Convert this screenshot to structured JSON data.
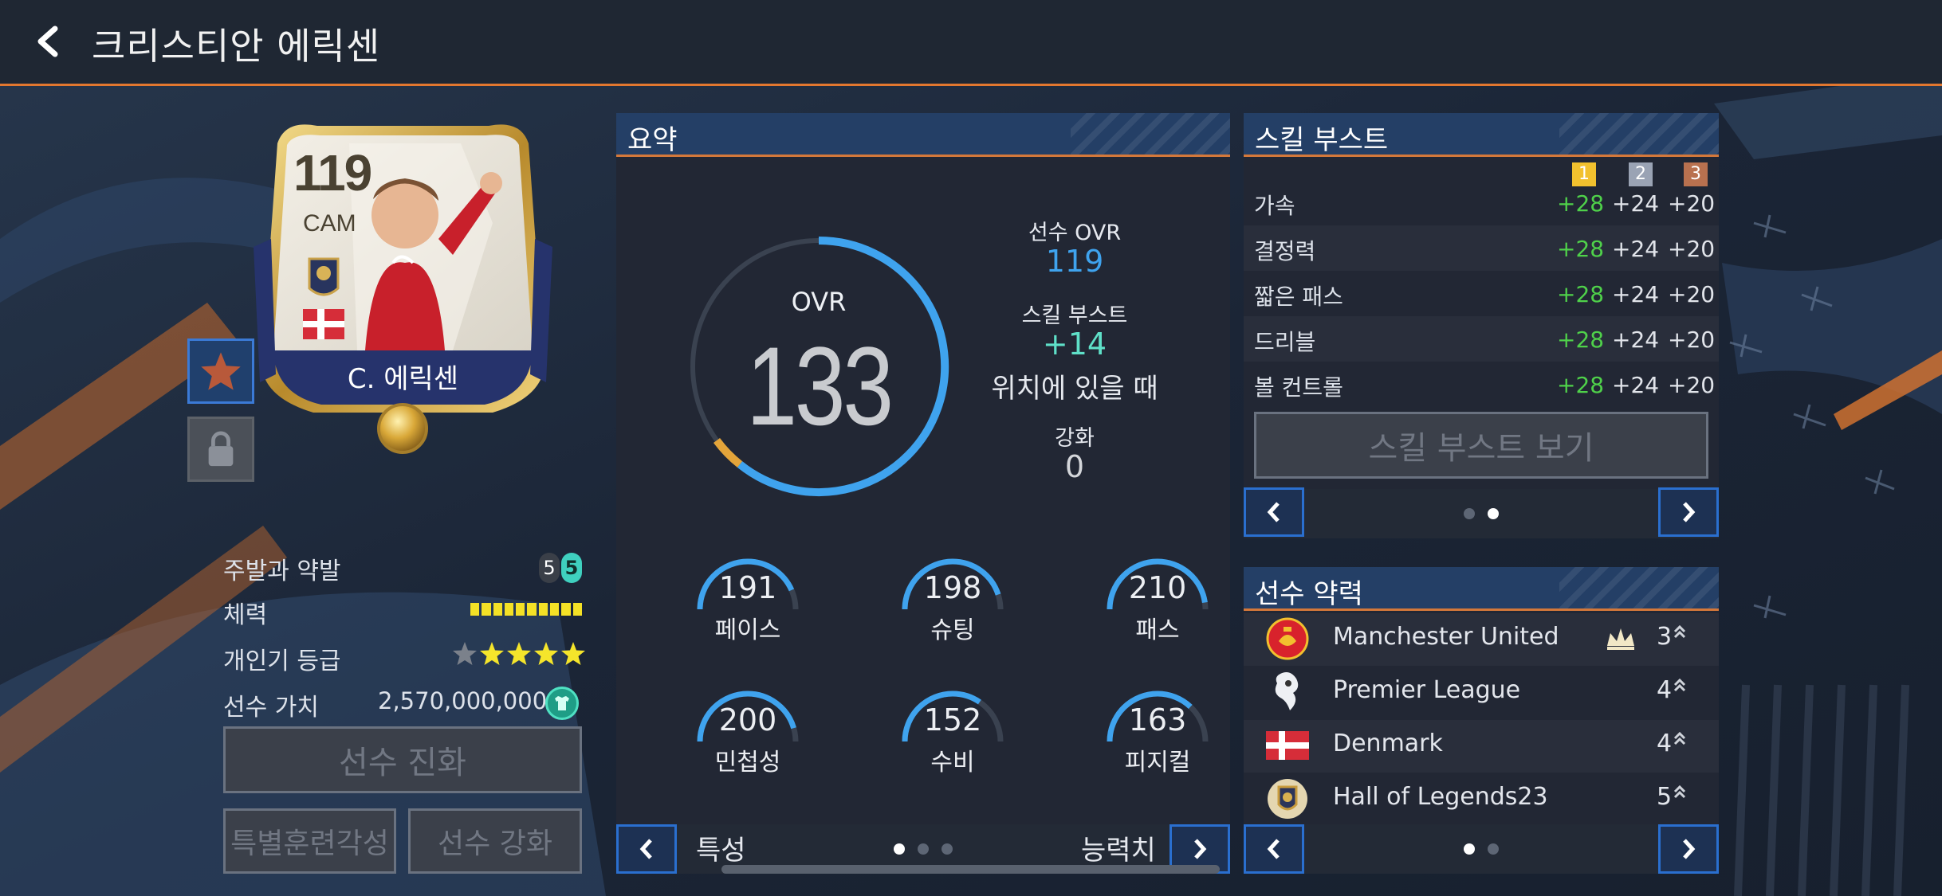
{
  "header": {
    "title": "크리스티안 에릭센"
  },
  "card": {
    "ovr": "119",
    "position": "CAM",
    "name": "C. 에릭센"
  },
  "info": {
    "foot_label": "주발과 약발",
    "foot_left": "5",
    "foot_right": "5",
    "stamina_label": "체력",
    "popularity_label": "개인기 등급",
    "popularity_stars_filled": 4,
    "popularity_stars_total": 5,
    "value_label": "선수 가치",
    "value": "2,570,000,000",
    "evolve_button": "선수 진화",
    "special_training_button": "특별훈련각성",
    "enhance_button": "선수 강화"
  },
  "summary": {
    "title": "요약",
    "ovr_label": "OVR",
    "ovr": "133",
    "player_ovr_label": "선수 OVR",
    "player_ovr": "119",
    "skill_boost_label": "스킬 부스트",
    "skill_boost": "+14",
    "position_note": "위치에 있을 때",
    "enhance_label": "강화",
    "enhance": "0",
    "stats": [
      {
        "value": "191",
        "label": "페이스"
      },
      {
        "value": "198",
        "label": "슈팅"
      },
      {
        "value": "210",
        "label": "패스"
      },
      {
        "value": "200",
        "label": "민첩성"
      },
      {
        "value": "152",
        "label": "수비"
      },
      {
        "value": "163",
        "label": "피지컬"
      }
    ],
    "nav_left": "특성",
    "nav_right": "능력치"
  },
  "skill_boost": {
    "title": "스킬 부스트",
    "headers": [
      "1",
      "2",
      "3"
    ],
    "rows": [
      {
        "label": "가속",
        "v1": "+28",
        "v2": "+24",
        "v3": "+20"
      },
      {
        "label": "결정력",
        "v1": "+28",
        "v2": "+24",
        "v3": "+20"
      },
      {
        "label": "짧은 패스",
        "v1": "+28",
        "v2": "+24",
        "v3": "+20"
      },
      {
        "label": "드리블",
        "v1": "+28",
        "v2": "+24",
        "v3": "+20"
      },
      {
        "label": "볼 컨트롤",
        "v1": "+28",
        "v2": "+24",
        "v3": "+20"
      }
    ],
    "view_button": "스킬 부스트 보기"
  },
  "player_bio": {
    "title": "선수 약력",
    "rows": [
      {
        "name": "Manchester United",
        "level": "3"
      },
      {
        "name": "Premier League",
        "level": "4"
      },
      {
        "name": "Denmark",
        "level": "4"
      },
      {
        "name": "Hall of Legends23",
        "level": "5"
      }
    ]
  },
  "colors": {
    "accent_orange": "#e2772f",
    "header_blue": "#243f66",
    "ring_blue": "#3fa3ee",
    "ring_gold": "#e3a43a",
    "stat_green": "#4fd14a",
    "boost_teal": "#5fe0c8"
  },
  "icons": {
    "back": "chevron-left-icon",
    "favorite": "star-icon",
    "lock": "lock-icon",
    "value": "shirt-coin-icon"
  }
}
